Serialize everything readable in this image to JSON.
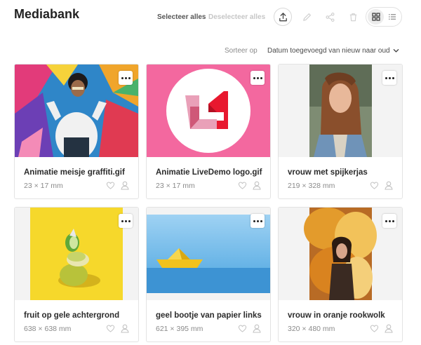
{
  "header": {
    "title": "Mediabank",
    "select_all": "Selecteer alles",
    "deselect_all": "Deselecteer alles"
  },
  "toolbar": {
    "icons": [
      "upload-icon",
      "pencil-icon",
      "share-icon",
      "trash-icon",
      "grid-view-icon",
      "list-view-icon"
    ],
    "active_view": "grid"
  },
  "sort": {
    "label": "Sorteer op",
    "value": "Datum toegevoegd van nieuw naar oud"
  },
  "items": [
    {
      "name": "Animatie meisje graffiti.gif",
      "size": "23 × 17 mm"
    },
    {
      "name": "Animatie LiveDemo logo.gif",
      "size": "23 × 17 mm"
    },
    {
      "name": "vrouw met spijkerjas",
      "size": "219 × 328 mm"
    },
    {
      "name": "fruit op gele achtergrond",
      "size": "638 × 638 mm"
    },
    {
      "name": "geel bootje van papier links",
      "size": "621 × 395 mm"
    },
    {
      "name": "vrouw in oranje rookwolk",
      "size": "320 × 480 mm"
    }
  ],
  "colors": {
    "accent_pink": "#f3689f",
    "logo_red": "#e8182f",
    "yellow_bg": "#f6d82b",
    "sky_blue": "#69b9ec",
    "smoke_orange": "#e39b2c"
  }
}
